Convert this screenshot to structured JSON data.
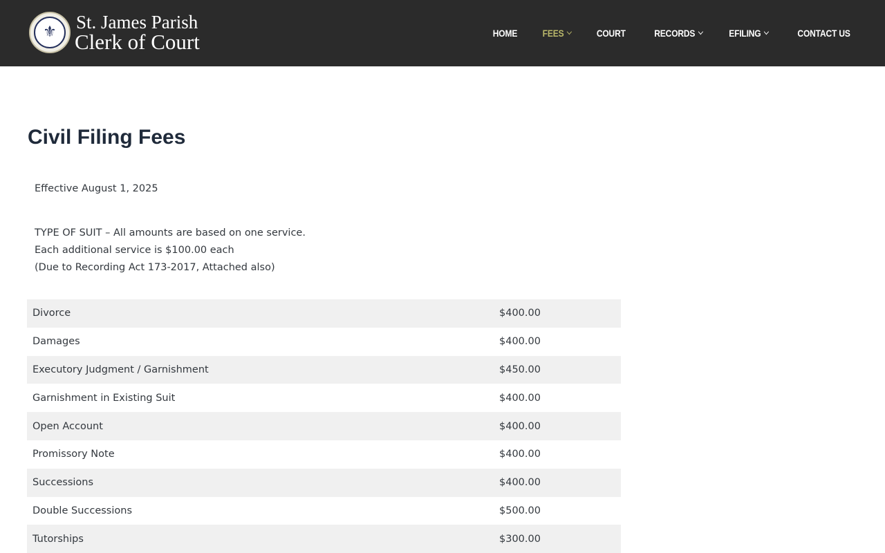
{
  "header": {
    "brand_line1": "St. James Parish",
    "brand_line2": "Clerk of Court",
    "logo_icon": "parish-seal-icon",
    "nav": [
      {
        "label": "HOME",
        "has_dropdown": false,
        "active": false
      },
      {
        "label": "FEES",
        "has_dropdown": true,
        "active": true
      },
      {
        "label": "COURT",
        "has_dropdown": false,
        "active": false
      },
      {
        "label": "RECORDS",
        "has_dropdown": true,
        "active": false
      },
      {
        "label": "EFILING",
        "has_dropdown": true,
        "active": false
      },
      {
        "label": "CONTACT US",
        "has_dropdown": false,
        "active": false
      }
    ]
  },
  "main": {
    "title": "Civil Filing Fees",
    "effective": "Effective August 1, 2025",
    "notes": [
      "TYPE OF SUIT – All amounts are based on one service.",
      "Each additional service is $100.00 each",
      "(Due to Recording Act 173-2017, Attached also)"
    ],
    "fees": [
      {
        "name": "Divorce",
        "amount": "$400.00"
      },
      {
        "name": "Damages",
        "amount": "$400.00"
      },
      {
        "name": "Executory Judgment / Garnishment",
        "amount": "$450.00"
      },
      {
        "name": "Garnishment in Existing Suit",
        "amount": "$400.00"
      },
      {
        "name": "Open Account",
        "amount": "$400.00"
      },
      {
        "name": "Promissory Note",
        "amount": "$400.00"
      },
      {
        "name": "Successions",
        "amount": "$400.00"
      },
      {
        "name": "Double Successions",
        "amount": "$500.00"
      },
      {
        "name": "Tutorships",
        "amount": "$300.00"
      }
    ]
  },
  "colors": {
    "header_bg": "#2b2b2b",
    "nav_active": "#b9b76a",
    "row_alt": "#f0f0f0",
    "title": "#1f2a3a"
  }
}
